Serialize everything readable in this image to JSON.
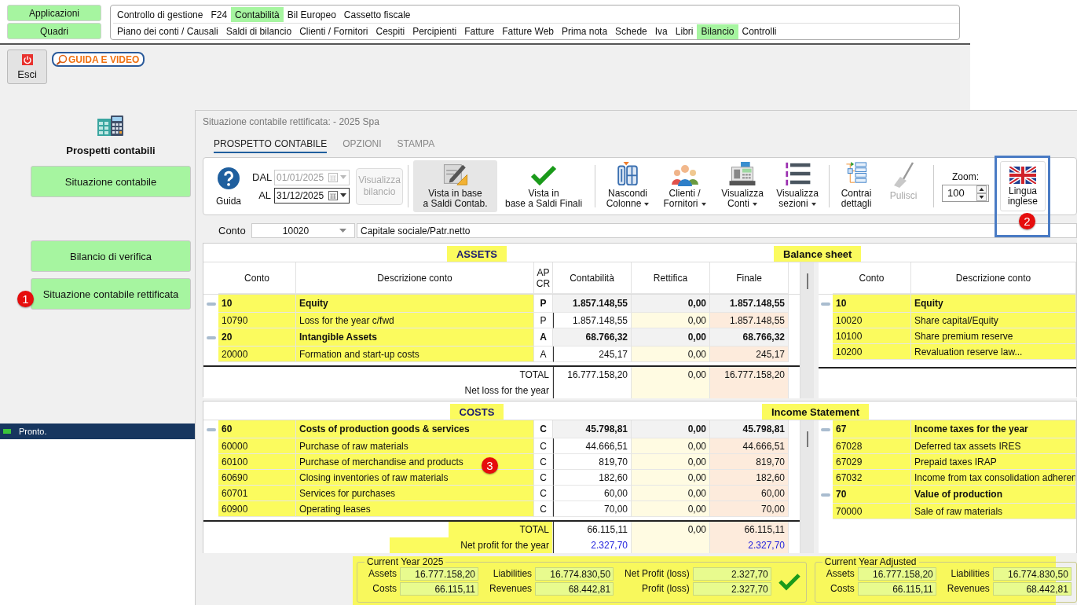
{
  "app_buttons": [
    "Applicazioni",
    "Quadri"
  ],
  "menu": [
    [
      {
        "label": "Controllo di gestione",
        "selected": false
      },
      {
        "label": "F24",
        "selected": false
      },
      {
        "label": "Contabilità",
        "selected": true
      },
      {
        "label": "Bil Europeo",
        "selected": false
      },
      {
        "label": "Cassetto fiscale",
        "selected": false
      }
    ],
    [
      {
        "label": "Piano dei conti / Causali",
        "selected": false
      },
      {
        "label": "Saldi di bilancio",
        "selected": false
      },
      {
        "label": "Clienti / Fornitori",
        "selected": false
      },
      {
        "label": "Cespiti",
        "selected": false
      },
      {
        "label": "Percipienti",
        "selected": false
      },
      {
        "label": "Fatture",
        "selected": false
      },
      {
        "label": "Fatture Web",
        "selected": false
      },
      {
        "label": "Prima nota",
        "selected": false
      },
      {
        "label": "Schede",
        "selected": false
      },
      {
        "label": "Iva",
        "selected": false
      },
      {
        "label": "Libri",
        "selected": false
      },
      {
        "label": "Bilancio",
        "selected": true
      },
      {
        "label": "Controlli",
        "selected": false
      }
    ]
  ],
  "exit_button": "Esci",
  "guide_logo": "GUIDA E VIDEO",
  "left_panel": {
    "title": "Prospetti contabili",
    "buttons": [
      {
        "label": "Situazione contabile"
      },
      {
        "label": "Bilancio di verifica"
      },
      {
        "label": "Situazione contabile rettificata",
        "callout": "1"
      }
    ]
  },
  "status_bar": "Pronto.",
  "dialog": {
    "title": "Situazione contabile rettificata:  - 2025 Spa",
    "tabs": [
      {
        "label": "PROSPETTO CONTABILE",
        "selected": true
      },
      {
        "label": "OPZIONI",
        "selected": false
      },
      {
        "label": "STAMPA",
        "selected": false
      }
    ],
    "toolbar": {
      "help": "Guida",
      "dates": [
        {
          "label": "DAL",
          "value": "01/01/2025",
          "disabled": true
        },
        {
          "label": "AL",
          "value": "31/12/2025",
          "disabled": false
        }
      ],
      "show_button": {
        "label": "Visualizza\nbilancio",
        "disabled": true
      },
      "groups": [
        [
          {
            "kind": "edit",
            "label": "Vista in base\na Saldi Contab.",
            "selected": true,
            "dropdown": false,
            "disabled": false
          },
          {
            "kind": "check",
            "label": "Vista in\nbase a Saldi Finali",
            "selected": false,
            "dropdown": false,
            "disabled": false
          }
        ],
        [
          {
            "kind": "columns",
            "label": "Nascondi\nColonne",
            "selected": false,
            "dropdown": true,
            "disabled": false
          },
          {
            "kind": "people",
            "label": "Clienti /\nFornitori",
            "selected": false,
            "dropdown": true,
            "disabled": false
          },
          {
            "kind": "register",
            "label": "Visualizza\nConti",
            "selected": false,
            "dropdown": true,
            "disabled": false
          },
          {
            "kind": "sections",
            "label": "Visualizza\nsezioni",
            "selected": false,
            "dropdown": true,
            "disabled": false
          }
        ],
        [
          {
            "kind": "collapse",
            "label": "Contrai\ndettagli",
            "selected": false,
            "dropdown": false,
            "disabled": false
          },
          {
            "kind": "broom",
            "label": "Pulisci",
            "selected": false,
            "dropdown": false,
            "disabled": true
          }
        ]
      ],
      "zoom": {
        "label": "Zoom:",
        "value": "100"
      },
      "language_button": {
        "label": "Lingua\ninglese",
        "highlighted": true,
        "callout": "2"
      }
    },
    "account": {
      "label": "Conto",
      "code": "10020",
      "description": "Capitale sociale/Patr.netto"
    },
    "sections": [
      {
        "left": {
          "heading": "ASSETS",
          "columns": [
            "Conto",
            "Descrizione conto",
            "AP CR",
            "Contabilità",
            "Rettifica",
            "Finale"
          ],
          "rows": [
            {
              "kind": "group",
              "code": "10",
              "description": "Equity",
              "ap_cr": "P",
              "contabilita": "1.857.148,55",
              "rettifica": "0,00",
              "finale": "1.857.148,55"
            },
            {
              "kind": "detail",
              "code": "10790",
              "description": "Loss for the year c/fwd",
              "ap_cr": "P",
              "contabilita": "1.857.148,55",
              "rettifica": "0,00",
              "finale": "1.857.148,55"
            },
            {
              "kind": "group",
              "code": "20",
              "description": "Intangible Assets",
              "ap_cr": "A",
              "contabilita": "68.766,32",
              "rettifica": "0,00",
              "finale": "68.766,32"
            },
            {
              "kind": "detail",
              "code": "20000",
              "description": "Formation and start-up costs",
              "ap_cr": "A",
              "contabilita": "245,17",
              "rettifica": "0,00",
              "finale": "245,17"
            }
          ],
          "totals": [
            {
              "kind": "total",
              "label": "TOTAL",
              "highlighted": false,
              "contabilita": "16.777.158,20",
              "rettifica": "0,00",
              "finale": "16.777.158,20"
            },
            {
              "kind": "result",
              "label": "Net loss for the year",
              "highlighted": false
            }
          ]
        },
        "right": {
          "heading": "Balance sheet",
          "columns": [
            "Conto",
            "Descrizione conto"
          ],
          "rows": [
            {
              "kind": "group",
              "code": "10",
              "description": "Equity"
            },
            {
              "kind": "detail",
              "code": "10020",
              "description": "Share capital/Equity"
            },
            {
              "kind": "detail",
              "code": "10100",
              "description": "Share premium reserve"
            },
            {
              "kind": "detail",
              "code": "10200",
              "description": "Revaluation reserve law..."
            }
          ]
        }
      },
      {
        "left": {
          "heading": "COSTS",
          "callout": "3",
          "rows": [
            {
              "kind": "group",
              "code": "60",
              "description": "Costs of production goods & services",
              "ap_cr": "C",
              "contabilita": "45.798,81",
              "rettifica": "0,00",
              "finale": "45.798,81"
            },
            {
              "kind": "detail",
              "code": "60000",
              "description": "Purchase of raw materials",
              "ap_cr": "C",
              "contabilita": "44.666,51",
              "rettifica": "0,00",
              "finale": "44.666,51"
            },
            {
              "kind": "detail",
              "code": "60100",
              "description": "Purchase of merchandise and products",
              "ap_cr": "C",
              "contabilita": "819,70",
              "rettifica": "0,00",
              "finale": "819,70"
            },
            {
              "kind": "detail",
              "code": "60690",
              "description": "Closing inventories of raw materials",
              "ap_cr": "C",
              "contabilita": "182,60",
              "rettifica": "0,00",
              "finale": "182,60"
            },
            {
              "kind": "detail",
              "code": "60701",
              "description": "Services for purchases",
              "ap_cr": "C",
              "contabilita": "60,00",
              "rettifica": "0,00",
              "finale": "60,00"
            },
            {
              "kind": "detail",
              "code": "60900",
              "description": "Operating leases",
              "ap_cr": "C",
              "contabilita": "70,00",
              "rettifica": "0,00",
              "finale": "70,00"
            }
          ],
          "totals": [
            {
              "kind": "total",
              "label": "TOTAL",
              "highlighted": true,
              "contabilita": "66.115,11",
              "rettifica": "0,00",
              "finale": "66.115,11"
            },
            {
              "kind": "result",
              "label": "Net profit for the year",
              "highlighted": true,
              "contabilita": "2.327,70",
              "finale": "2.327,70"
            }
          ]
        },
        "right": {
          "heading": "Income Statement",
          "rows": [
            {
              "kind": "group",
              "code": "67",
              "description": "Income taxes for the year"
            },
            {
              "kind": "detail",
              "code": "67028",
              "description": "Deferred tax assets IRES"
            },
            {
              "kind": "detail",
              "code": "67029",
              "description": "Prepaid taxes IRAP"
            },
            {
              "kind": "detail",
              "code": "67032",
              "description": "Income from tax consolidation adheren"
            },
            {
              "kind": "group",
              "code": "70",
              "description": "Value of production"
            },
            {
              "kind": "detail",
              "code": "70000",
              "description": "Sale of raw materials"
            }
          ]
        }
      }
    ],
    "summary": [
      {
        "title": "Current Year 2025",
        "balanced": true,
        "rows": [
          [
            {
              "label": "Assets",
              "value": "16.777.158,20"
            },
            {
              "label": "Liabilities",
              "value": "16.774.830,50"
            },
            {
              "label": "Net Profit (loss)",
              "value": "2.327,70"
            }
          ],
          [
            {
              "label": "Costs",
              "value": "66.115,11"
            },
            {
              "label": "Revenues",
              "value": "68.442,81"
            },
            {
              "label": "Profit (loss)",
              "value": "2.327,70"
            }
          ]
        ]
      },
      {
        "title": "Current Year Adjusted",
        "balanced": false,
        "rows": [
          [
            {
              "label": "Assets",
              "value": "16.777.158,20"
            },
            {
              "label": "Liabilities",
              "value": "16.774.830,50"
            }
          ],
          [
            {
              "label": "Costs",
              "value": "66.115,11"
            },
            {
              "label": "Revenues",
              "value": "68.442,81"
            }
          ]
        ]
      }
    ]
  }
}
